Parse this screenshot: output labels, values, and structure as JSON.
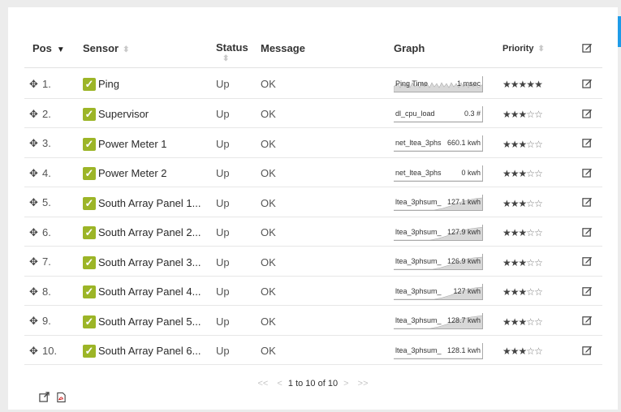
{
  "header": {
    "pos": "Pos",
    "sensor": "Sensor",
    "status": "Status",
    "message": "Message",
    "graph": "Graph",
    "priority": "Priority"
  },
  "rows": [
    {
      "pos": "1.",
      "sensor": "Ping",
      "status": "Up",
      "message": "OK",
      "graph_label": "Ping Time",
      "graph_value": "1 msec",
      "stars": 5
    },
    {
      "pos": "2.",
      "sensor": "Supervisor",
      "status": "Up",
      "message": "OK",
      "graph_label": "dl_cpu_load",
      "graph_value": "0.3 #",
      "stars": 3
    },
    {
      "pos": "3.",
      "sensor": "Power Meter 1",
      "status": "Up",
      "message": "OK",
      "graph_label": "net_ltea_3phs",
      "graph_value": "660.1 kwh",
      "stars": 3
    },
    {
      "pos": "4.",
      "sensor": "Power Meter 2",
      "status": "Up",
      "message": "OK",
      "graph_label": "net_ltea_3phs",
      "graph_value": "0 kwh",
      "stars": 3
    },
    {
      "pos": "5.",
      "sensor": "South Array Panel 1...",
      "status": "Up",
      "message": "OK",
      "graph_label": "ltea_3phsum_",
      "graph_value": "127.1 kwh",
      "stars": 3
    },
    {
      "pos": "6.",
      "sensor": "South Array Panel 2...",
      "status": "Up",
      "message": "OK",
      "graph_label": "ltea_3phsum_",
      "graph_value": "127.9 kwh",
      "stars": 3
    },
    {
      "pos": "7.",
      "sensor": "South Array Panel 3...",
      "status": "Up",
      "message": "OK",
      "graph_label": "ltea_3phsum_",
      "graph_value": "126.9 kwh",
      "stars": 3
    },
    {
      "pos": "8.",
      "sensor": "South Array Panel 4...",
      "status": "Up",
      "message": "OK",
      "graph_label": "ltea_3phsum_",
      "graph_value": "127 kwh",
      "stars": 3
    },
    {
      "pos": "9.",
      "sensor": "South Array Panel 5...",
      "status": "Up",
      "message": "OK",
      "graph_label": "ltea_3phsum_",
      "graph_value": "128.7 kwh",
      "stars": 3
    },
    {
      "pos": "10.",
      "sensor": "South Array Panel 6...",
      "status": "Up",
      "message": "OK",
      "graph_label": "ltea_3phsum_",
      "graph_value": "128.1 kwh",
      "stars": 3
    }
  ],
  "pager": {
    "first": "<<",
    "prev": "<",
    "summary": "1 to 10 of 10",
    "next": ">",
    "last": ">>"
  },
  "icons": {
    "move": "move-icon",
    "check": "check-icon",
    "edit": "edit-icon",
    "external": "external-link-icon",
    "pdf": "pdf-icon"
  },
  "colors": {
    "check": "#9cb527",
    "accent": "#1e9be8"
  }
}
